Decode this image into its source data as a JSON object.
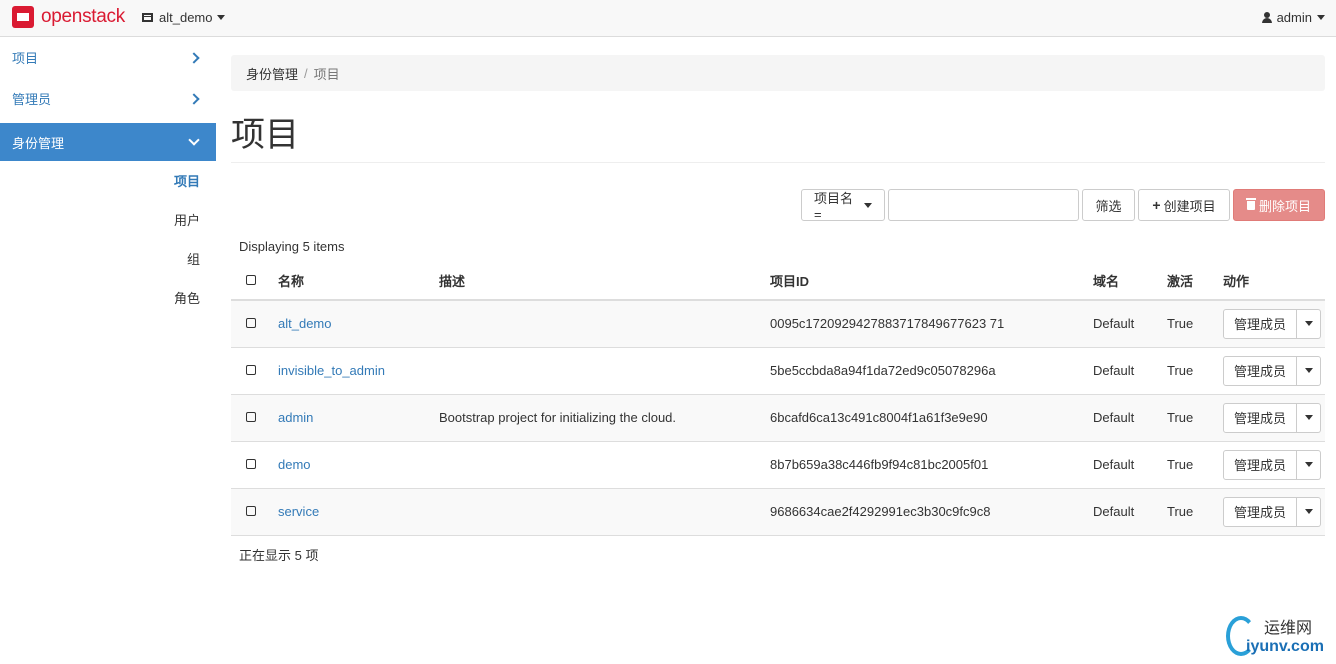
{
  "topbar": {
    "brand": "openstack",
    "project": "alt_demo",
    "user": "admin"
  },
  "sidebar": {
    "sections": [
      {
        "label": "项目"
      },
      {
        "label": "管理员"
      },
      {
        "label": "身份管理"
      }
    ],
    "sub_items": [
      {
        "label": "项目"
      },
      {
        "label": "用户"
      },
      {
        "label": "组"
      },
      {
        "label": "角色"
      }
    ]
  },
  "breadcrumb": {
    "parent": "身份管理",
    "separator": "/",
    "current": "项目"
  },
  "page_title": "项目",
  "toolbar": {
    "filter_field": "项目名=",
    "search_value": "",
    "filter_label": "筛选",
    "create_label": "创建项目",
    "delete_label": "删除项目"
  },
  "table": {
    "count_top": "Displaying 5 items",
    "count_bottom": "正在显示 5 项",
    "headers": [
      "名称",
      "描述",
      "项目ID",
      "域名",
      "激活",
      "动作"
    ],
    "rows": [
      {
        "name": "alt_demo",
        "description": "",
        "id": "0095c1720929427883717849677623 71",
        "domain": "Default",
        "enabled": "True",
        "action": "管理成员"
      },
      {
        "name": "invisible_to_admin",
        "description": "",
        "id": "5be5ccbda8a94f1da72ed9c05078296a",
        "domain": "Default",
        "enabled": "True",
        "action": "管理成员"
      },
      {
        "name": "admin",
        "description": "Bootstrap project for initializing the cloud.",
        "id": "6bcafd6ca13c491c8004f1a61f3e9e90",
        "domain": "Default",
        "enabled": "True",
        "action": "管理成员"
      },
      {
        "name": "demo",
        "description": "",
        "id": "8b7b659a38c446fb9f94c81bc2005f01",
        "domain": "Default",
        "enabled": "True",
        "action": "管理成员"
      },
      {
        "name": "service",
        "description": "",
        "id": "9686634cae2f4292991ec3b30c9fc9c8",
        "domain": "Default",
        "enabled": "True",
        "action": "管理成员"
      }
    ]
  },
  "watermark": {
    "top": "运维网",
    "bottom": "iyunv.com"
  },
  "colors": {
    "brand": "#da1a32",
    "link": "#337ab7",
    "active_nav": "#3d87cb",
    "danger": "#e58b89"
  }
}
